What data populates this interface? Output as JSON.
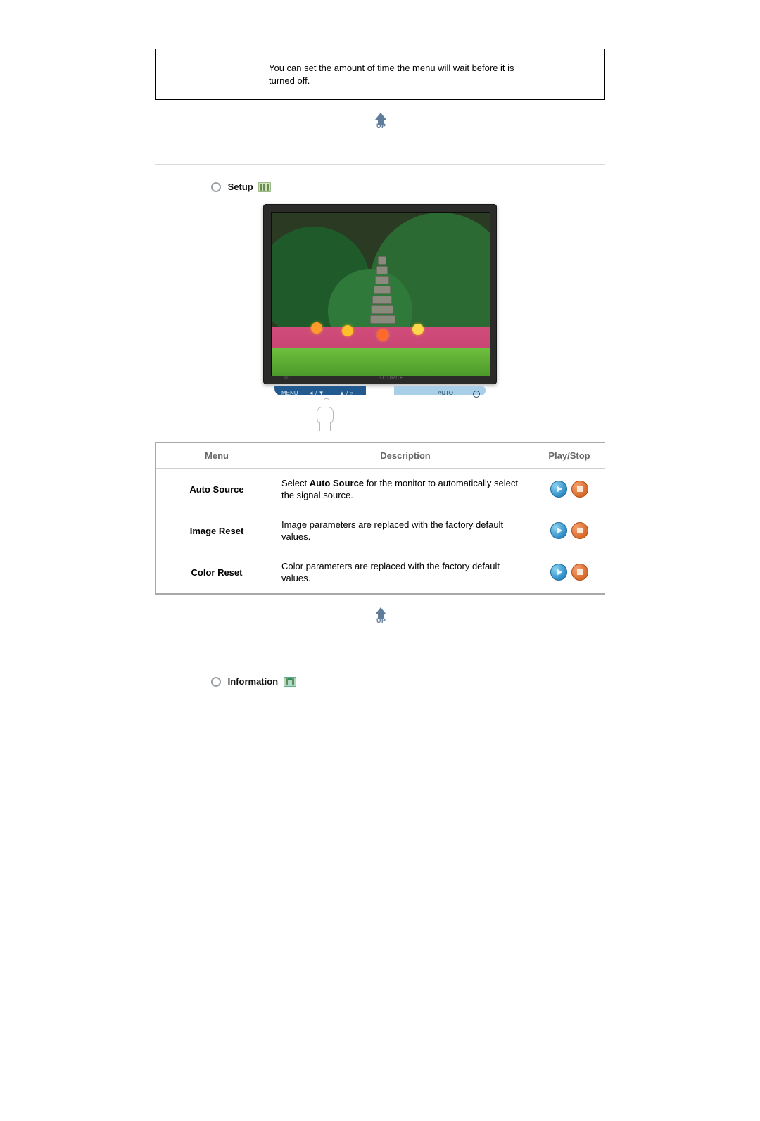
{
  "top_note": "You can set the amount of time the menu will wait before it is turned off.",
  "up_label": "UP",
  "sections": {
    "setup_title": "Setup",
    "information_title": "Information"
  },
  "osd": {
    "menu": "MENU",
    "source": "SOURCE",
    "auto": "AUTO",
    "sym1": "III",
    "sym2": "◄ / ▼",
    "sym3": "▲ / ○",
    "power": "○"
  },
  "table": {
    "headers": {
      "menu": "Menu",
      "description": "Description",
      "playstop": "Play/Stop"
    },
    "rows": [
      {
        "menu": "Auto Source",
        "desc_pre": "Select ",
        "desc_bold": "Auto Source",
        "desc_post": " for the monitor to automatically select the signal source."
      },
      {
        "menu": "Image Reset",
        "desc": "Image parameters are replaced with the factory default values."
      },
      {
        "menu": "Color Reset",
        "desc": "Color parameters are replaced with the factory default values."
      }
    ]
  }
}
